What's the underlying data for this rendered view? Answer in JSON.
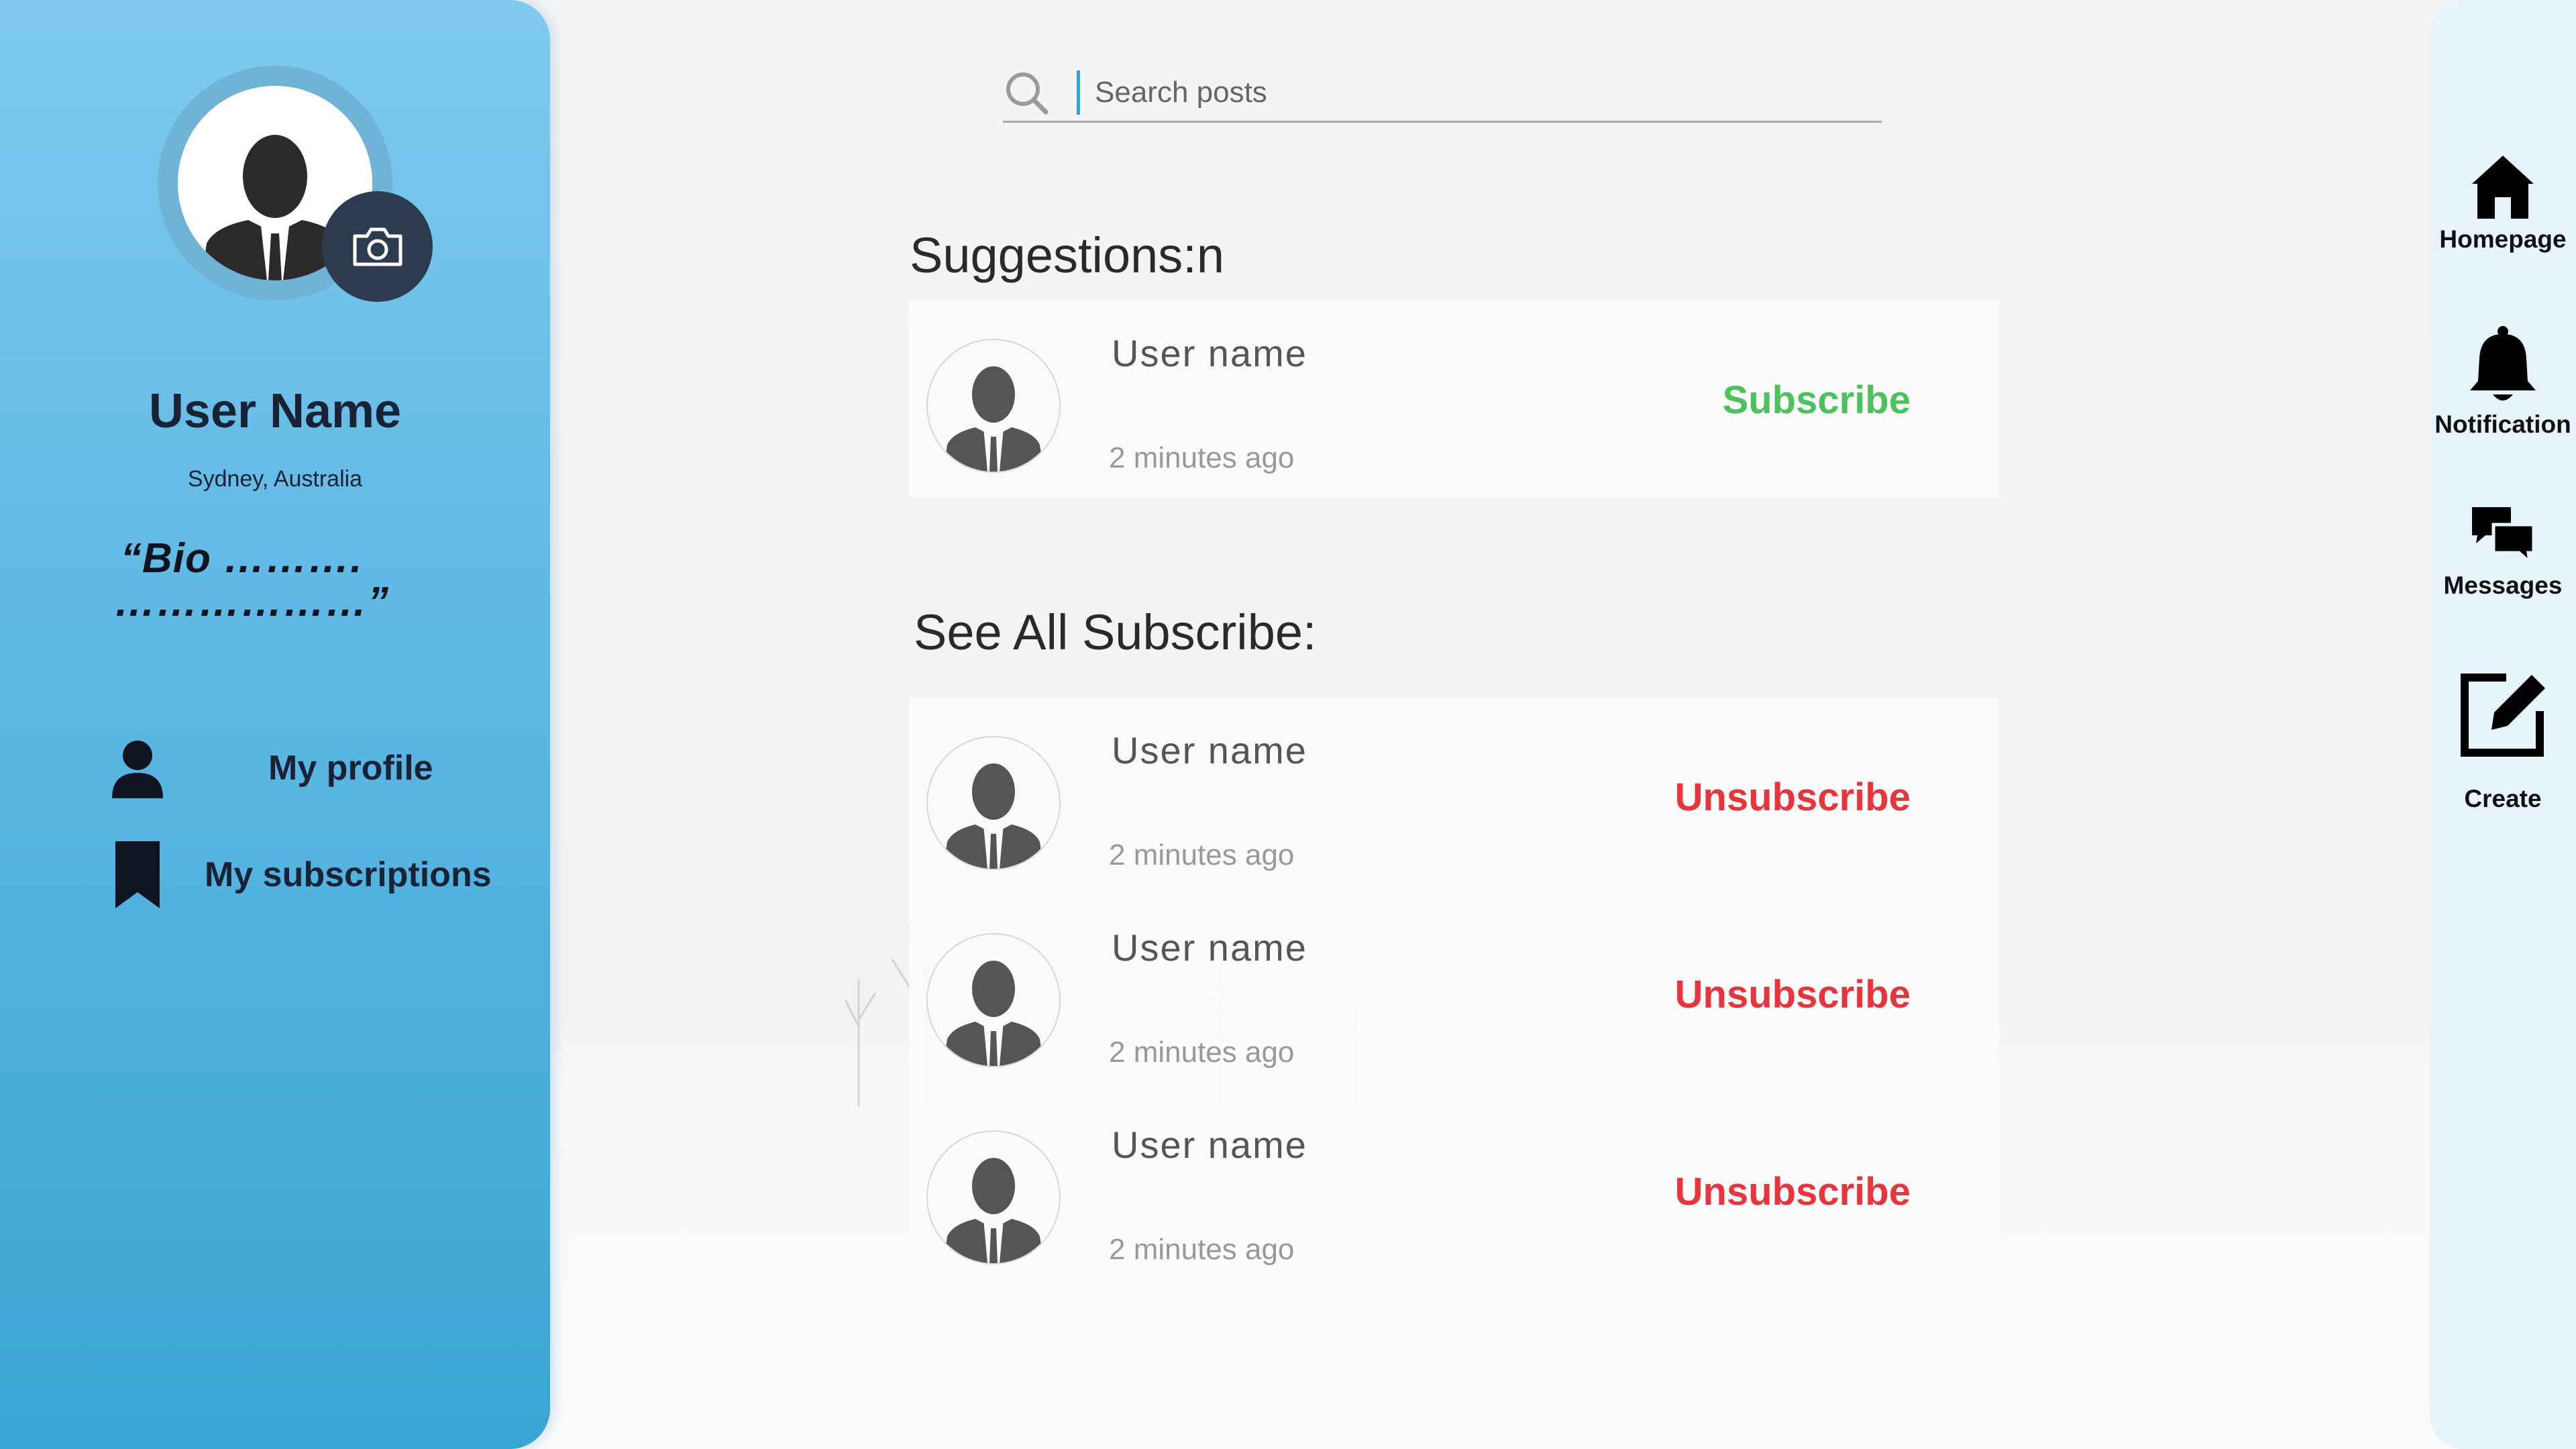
{
  "profile": {
    "name": "User Name",
    "location": "Sydney, Australia",
    "bio_line1": "“Bio ……….",
    "bio_line2": "………………”"
  },
  "sidebar": {
    "items": [
      {
        "label": "My profile",
        "icon": "person-icon"
      },
      {
        "label": "My subscriptions",
        "icon": "bookmark-icon"
      }
    ]
  },
  "search": {
    "placeholder": "Search posts",
    "value": ""
  },
  "suggestions": {
    "heading": "Suggestions:n",
    "items": [
      {
        "name": "User name",
        "time": "2 minutes ago",
        "action": "Subscribe"
      }
    ]
  },
  "subscriptions": {
    "heading": "See All Subscribe:",
    "items": [
      {
        "name": "User name",
        "time": "2 minutes ago",
        "action": "Unsubscribe"
      },
      {
        "name": "User name",
        "time": "2 minutes ago",
        "action": "Unsubscribe"
      },
      {
        "name": "User name",
        "time": "2 minutes ago",
        "action": "Unsubscribe"
      }
    ]
  },
  "right_nav": {
    "items": [
      {
        "label": "Homepage",
        "icon": "home-icon"
      },
      {
        "label": "Notification",
        "icon": "bell-icon"
      },
      {
        "label": "Messages",
        "icon": "chat-icon"
      },
      {
        "label": "Create",
        "icon": "edit-icon"
      }
    ]
  },
  "colors": {
    "sidebar_top": "#7fc9ee",
    "sidebar_bottom": "#3aa5d3",
    "subscribe": "#4cc25c",
    "unsubscribe": "#e8343c",
    "search_caret": "#2ba4e0",
    "right_nav_bg": "#e7f4fb"
  }
}
